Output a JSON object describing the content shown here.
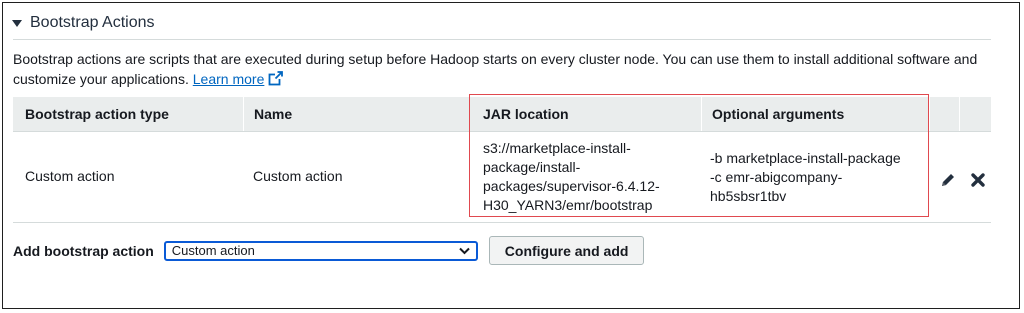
{
  "section": {
    "title": "Bootstrap Actions",
    "description": "Bootstrap actions are scripts that are executed during setup before Hadoop starts on every cluster node. You can use them to install additional software and customize your applications.",
    "learn_more": "Learn more"
  },
  "table": {
    "columns": [
      "Bootstrap action type",
      "Name",
      "JAR location",
      "Optional arguments"
    ],
    "rows": [
      {
        "type": "Custom action",
        "name": "Custom action",
        "jar_location": [
          "s3://marketplace-install-",
          "package/install-",
          "packages/supervisor-6.4.12-",
          "H30_YARN3/emr/bootstrap"
        ],
        "optional_arguments": [
          "-b marketplace-install-package",
          "-c emr-abigcompany-",
          "hb5sbsr1tbv"
        ]
      }
    ]
  },
  "add": {
    "label": "Add bootstrap action",
    "select_value": "Custom action",
    "button": "Configure and add"
  },
  "icons": {
    "collapse": "caret-down-icon",
    "external": "external-link-icon",
    "edit": "pencil-icon",
    "delete": "x-icon"
  },
  "colors": {
    "header_bg": "#eaeded",
    "link": "#0066c0",
    "highlight_border": "#e0494f",
    "select_border": "#0a5ad6"
  }
}
